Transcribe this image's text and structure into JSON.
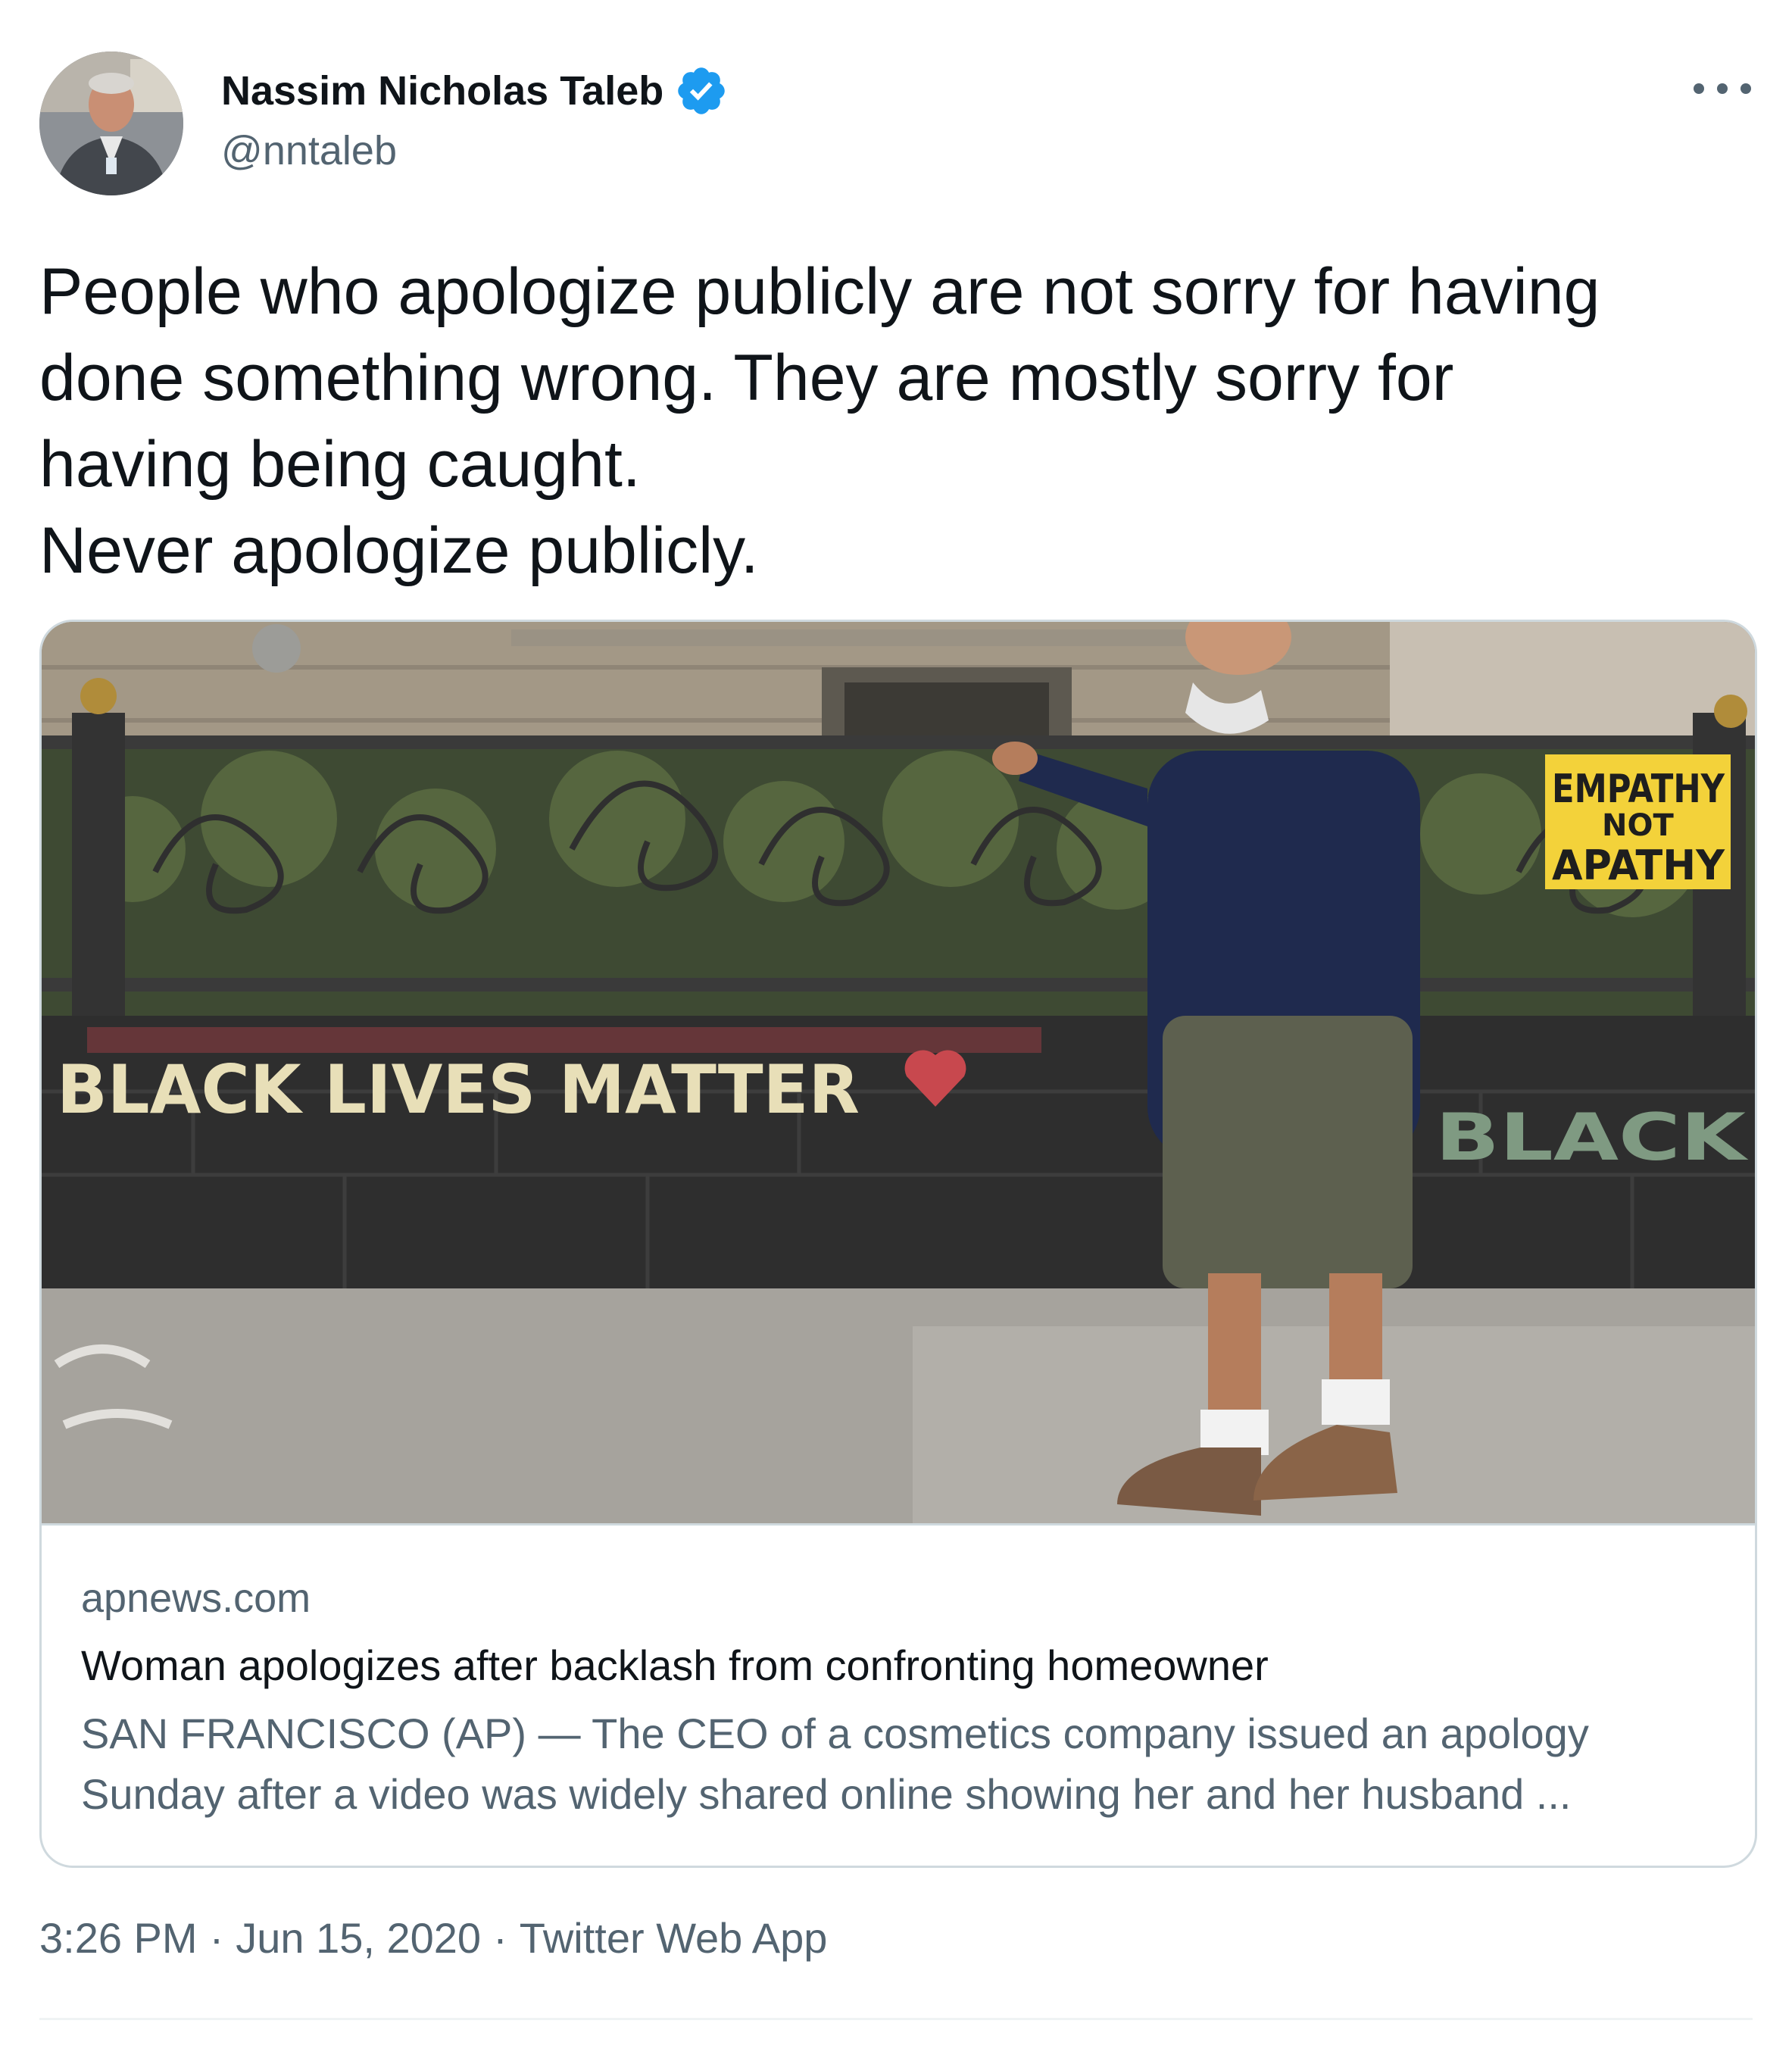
{
  "author": {
    "name": "Nassim Nicholas Taleb",
    "handle": "@nntaleb",
    "verified_badge_color": "#1d9bf0"
  },
  "tweet": {
    "lines": [
      "People who apologize publicly are not sorry for having",
      "done something wrong. They are mostly sorry for",
      "having being caught.",
      "Never apologize publicly."
    ]
  },
  "card": {
    "photo_text": {
      "wall_left": "BLACK LIVES MATTER",
      "wall_right": "BLACK",
      "sign_line1": "EMPATHY",
      "sign_line2": "NOT",
      "sign_line3": "APATHY"
    },
    "domain": "apnews.com",
    "title": "Woman apologizes after backlash from confronting homeowner",
    "description_lines": [
      "SAN FRANCISCO (AP) — The CEO of a cosmetics company issued an apology",
      "Sunday after a video was widely shared online showing her and her husband ..."
    ]
  },
  "meta": {
    "time": "3:26 PM",
    "date": "Jun 15, 2020",
    "source": "Twitter Web App",
    "separator": "·"
  },
  "icons": {
    "more": "more-horizontal-icon",
    "verified": "verified-badge-icon"
  }
}
